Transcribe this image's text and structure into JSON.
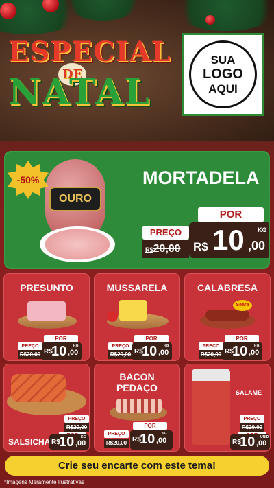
{
  "header": {
    "title_especial": "ESPECIAL",
    "title_de": "DE",
    "title_natal": "NATAL",
    "logo_lines": [
      "SUA",
      "LOGO",
      "AQUI"
    ]
  },
  "featured": {
    "discount": "-50%",
    "brand": "OURO",
    "name": "MORTADELA",
    "por_label": "POR",
    "preco_label": "PREÇO",
    "old_currency": "R$",
    "old_price": "20,00",
    "currency": "R$",
    "price_int": "10",
    "price_cents": ",00",
    "unit": "KG"
  },
  "products": [
    {
      "name": "PRESUNTO",
      "preco_label": "PREÇO",
      "old_price": "R$20,00",
      "por_label": "POR",
      "currency": "R$",
      "price_int": "10",
      "price_cents": ",00",
      "unit": "KG"
    },
    {
      "name": "MUSSARELA",
      "preco_label": "PREÇO",
      "old_price": "R$20,00",
      "por_label": "POR",
      "currency": "R$",
      "price_int": "10",
      "price_cents": ",00",
      "unit": "KG"
    },
    {
      "name": "CALABRESA",
      "brand": "Seara",
      "preco_label": "PREÇO",
      "old_price": "R$20,00",
      "por_label": "POR",
      "currency": "R$",
      "price_int": "10",
      "price_cents": ",00",
      "unit": "KG"
    },
    {
      "name": "SALSICHA",
      "preco_label": "PREÇO",
      "old_price": "R$20,00",
      "por_label": "POR",
      "currency": "R$",
      "price_int": "10",
      "price_cents": ",00",
      "unit": "KG"
    },
    {
      "name_line1": "BACON",
      "name_line2": "PEDAÇO",
      "preco_label": "PREÇO",
      "old_price": "R$20,00",
      "por_label": "POR",
      "currency": "R$",
      "price_int": "10",
      "price_cents": ",00",
      "unit": "KG"
    },
    {
      "name": "SALAME",
      "preco_label": "PREÇO",
      "old_price": "R$20,00",
      "por_label": "POR",
      "currency": "R$",
      "price_int": "10",
      "price_cents": ",00",
      "unit": "UNID"
    }
  ],
  "cta": "Crie seu encarte com este tema!",
  "footnote": "*Imagens Meramente Ilustrativas",
  "colors": {
    "green": "#2e8b3a",
    "red": "#c8333a",
    "yellow": "#f5d02e",
    "dark": "#3a2016"
  }
}
